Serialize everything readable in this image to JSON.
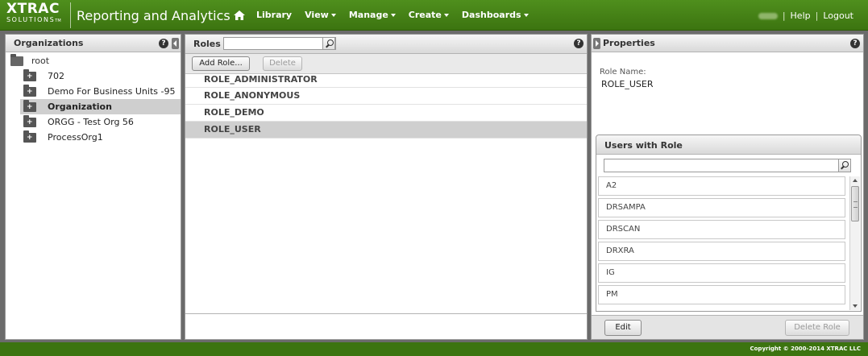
{
  "header": {
    "logo_line1": "XTRAC",
    "logo_line2": "SOLUTIONS",
    "logo_tm": "TM",
    "app_title": "Reporting and Analytics",
    "nav": [
      {
        "label": "Library",
        "dropdown": false
      },
      {
        "label": "View",
        "dropdown": true
      },
      {
        "label": "Manage",
        "dropdown": true
      },
      {
        "label": "Create",
        "dropdown": true
      },
      {
        "label": "Dashboards",
        "dropdown": true
      }
    ],
    "help_label": "Help",
    "logout_label": "Logout",
    "separator": "|"
  },
  "organizations": {
    "title": "Organizations",
    "root": "root",
    "items": [
      {
        "label": "702",
        "selected": false
      },
      {
        "label": "Demo For Business Units -95",
        "selected": false
      },
      {
        "label": "Organization",
        "selected": true
      },
      {
        "label": "ORGG - Test Org 56",
        "selected": false
      },
      {
        "label": "ProcessOrg1",
        "selected": false
      }
    ]
  },
  "roles": {
    "title": "Roles",
    "search_value": "",
    "add_label": "Add Role...",
    "delete_label": "Delete",
    "items": [
      {
        "label": "ROLE_ADMINISTRATOR",
        "selected": false
      },
      {
        "label": "ROLE_ANONYMOUS",
        "selected": false
      },
      {
        "label": "ROLE_DEMO",
        "selected": false
      },
      {
        "label": "ROLE_USER",
        "selected": true
      }
    ]
  },
  "properties": {
    "title": "Properties",
    "role_name_label": "Role Name:",
    "role_name_value": "ROLE_USER",
    "users_title": "Users with Role",
    "users_search_value": "",
    "users": [
      "A2",
      "DRSAMPA",
      "DRSCAN",
      "DRXRA",
      "IG",
      "PM"
    ],
    "edit_label": "Edit",
    "delete_role_label": "Delete Role"
  },
  "footer": {
    "copyright": "Copyright © 2000-2014 XTRAC LLC"
  },
  "colors": {
    "brand_green": "#3c7410",
    "selected_row": "#cfcfcf"
  },
  "icons": [
    "home-icon",
    "help-icon",
    "search-icon",
    "folder-icon",
    "collapse-left-icon",
    "expand-right-icon"
  ]
}
